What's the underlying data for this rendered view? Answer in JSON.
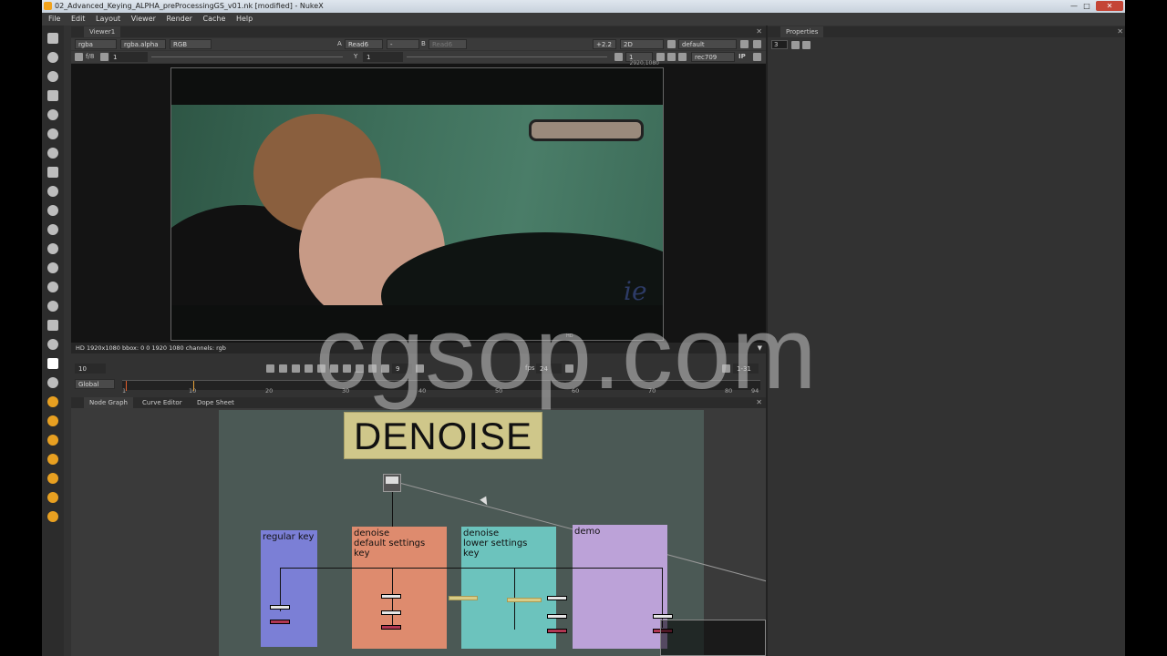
{
  "window": {
    "title": "02_Advanced_Keying_ALPHA_preProcessingGS_v01.nk [modified] - NukeX"
  },
  "menu": [
    "File",
    "Edit",
    "Layout",
    "Viewer",
    "Render",
    "Cache",
    "Help"
  ],
  "viewer": {
    "tab": "Viewer1",
    "channels": "rgba",
    "alpha": "rgba.alpha",
    "display": "RGB",
    "input_a_label": "A",
    "input_a": "Read6",
    "input_a_op": "-",
    "input_b_label": "B",
    "input_b": "Read6",
    "gain": "+2.2",
    "mode": "2D",
    "lut": "default",
    "fstop": "f/8",
    "gain_value": "1",
    "y_label": "Y",
    "y_value": "1",
    "proxy": "1",
    "colorspace": "rec709",
    "ip": "IP",
    "format_label": "2920,1080",
    "hd_corner": "HD",
    "logo_text": "ie",
    "info": "HD 1920x1080  bbox: 0 0 1920 1080  channels: rgb"
  },
  "playback": {
    "frame": "10",
    "increment": "9",
    "fps_label": "fps",
    "fps": "24",
    "range": "1-31",
    "scope": "Global",
    "ticks": [
      "1",
      "10",
      "20",
      "30",
      "40",
      "50",
      "60",
      "70",
      "80",
      "94"
    ]
  },
  "nodegraph": {
    "tabs": [
      "Node Graph",
      "Curve Editor",
      "Dope Sheet"
    ],
    "sticky": "DENOISE",
    "backdrops": [
      {
        "label": "regular key",
        "color": "#7b7fd6"
      },
      {
        "label": "denoise\ndefault settings\nkey",
        "color": "#de8b6e"
      },
      {
        "label": "denoise\nlower settings\nkey",
        "color": "#6cc3bd"
      },
      {
        "label": "demo",
        "color": "#bca2d8"
      }
    ]
  },
  "properties": {
    "tab": "Properties",
    "max_panels": "3"
  },
  "watermark": "cgsop.com"
}
